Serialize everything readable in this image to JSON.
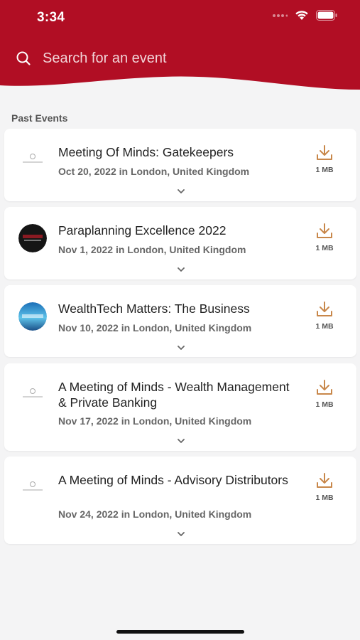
{
  "status": {
    "time": "3:34"
  },
  "search": {
    "placeholder": "Search for an event"
  },
  "section": {
    "title": "Past Events"
  },
  "colors": {
    "brand": "#b10e24",
    "accent": "#c8874a"
  },
  "events": [
    {
      "title": "Meeting Of Minds: Gatekeepers",
      "meta": "Oct 20, 2022 in London, United Kingdom",
      "size": "1 MB",
      "logo": "meeting-of-minds-logo"
    },
    {
      "title": "Paraplanning Excellence 2022",
      "meta": "Nov 1, 2022 in London, United Kingdom",
      "size": "1 MB",
      "logo": "paraplanning-excellence-logo"
    },
    {
      "title": "WealthTech Matters: The Business",
      "meta": "Nov 10, 2022 in London, United Kingdom",
      "size": "1 MB",
      "logo": "wealthtech-matters-logo"
    },
    {
      "title": "A Meeting of Minds - Wealth Management & Private Banking",
      "meta": "Nov 17, 2022 in London, United Kingdom",
      "size": "1 MB",
      "logo": "meeting-of-minds-logo"
    },
    {
      "title": "A Meeting of Minds - Advisory Distributors",
      "meta": "Nov 24, 2022 in London, United Kingdom",
      "size": "1 MB",
      "logo": "meeting-of-minds-logo"
    }
  ]
}
